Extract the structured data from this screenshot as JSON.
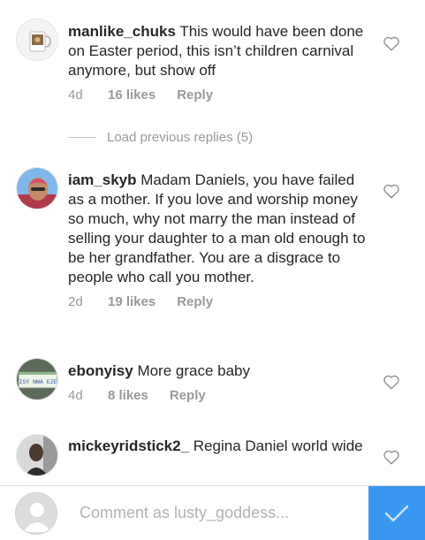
{
  "comments": [
    {
      "username": "manlike_chuks",
      "text": "This would have been done on Easter period, this isn’t children carnival anymore, but show off",
      "time": "4d",
      "likes": "16 likes",
      "reply": "Reply"
    },
    {
      "username": "iam_skyb",
      "text": "Madam Daniels, you have failed as a mother. If you love and worship money so much, why not marry the man instead of selling your daughter to a man old enough to be her grandfather. You are a disgrace to people who call you mother.",
      "time": "2d",
      "likes": "19 likes",
      "reply": "Reply"
    },
    {
      "username": "ebonyisy",
      "text": "More grace baby",
      "time": "4d",
      "likes": "8 likes",
      "reply": "Reply",
      "avatar_text": "ISY NWA EZE"
    },
    {
      "username": "mickeyridstick2_",
      "text": "Regina Daniel world wide"
    }
  ],
  "load_previous": "Load previous replies (5)",
  "composer": {
    "placeholder": "Comment as lusty_goddess..."
  },
  "colors": {
    "accent": "#3897f0",
    "meta": "#999999",
    "text": "#262626"
  },
  "icons": {
    "like": "heart-outline-icon",
    "send": "checkmark-icon"
  }
}
